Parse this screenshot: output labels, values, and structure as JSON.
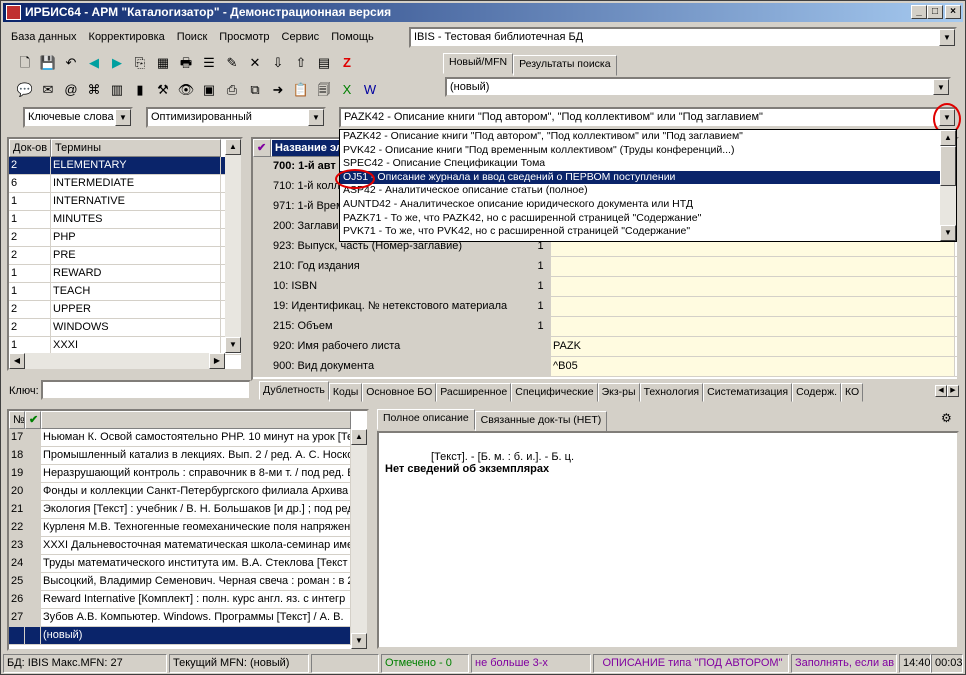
{
  "title": "ИРБИС64 - АРМ \"Каталогизатор\" - Демонстрационная версия",
  "menu": [
    "База данных",
    "Корректировка",
    "Поиск",
    "Просмотр",
    "Сервис",
    "Помощь"
  ],
  "db_combo": "IBIS - Тестовая библиотечная БД",
  "right_tabs": [
    "Новый/MFN",
    "Результаты поиска"
  ],
  "mfn_combo": "(новый)",
  "search_mode": "Ключевые слова",
  "opt_mode": "Оптимизированный",
  "worksheet_combo": "PAZK42 - Описание книги \"Под автором\", \"Под коллективом\" или \"Под заглавием\"",
  "dropdown_items": [
    "PAZK42 - Описание книги \"Под автором\", \"Под коллективом\" или \"Под заглавием\"",
    "PVK42 - Описание книги \"Под временным коллективом\" (Труды конференций...)",
    "SPEC42 - Описание Спецификации Тома",
    "OJ51 - Описание журнала и ввод сведений о ПЕРВОМ поступлении",
    "ASP42 - Аналитическое описание статьи (полное)",
    "AUNTD42 - Аналитическое описание юридического документа или НТД",
    "PAZK71 - То же, что PAZK42, но с расширенной страницей \"Содержание\"",
    "PVK71 - То же, что PVK42, но с расширенной страницей \"Содержание\""
  ],
  "terms": {
    "col_docs": "Док-ов",
    "col_terms": "Термины",
    "rows": [
      {
        "n": "2",
        "t": "ELEMENTARY"
      },
      {
        "n": "6",
        "t": "INTERMEDIATE"
      },
      {
        "n": "1",
        "t": "INTERNATIVE"
      },
      {
        "n": "1",
        "t": "MINUTES"
      },
      {
        "n": "2",
        "t": "PHP"
      },
      {
        "n": "2",
        "t": "PRE"
      },
      {
        "n": "1",
        "t": "REWARD"
      },
      {
        "n": "1",
        "t": "TEACH"
      },
      {
        "n": "2",
        "t": "UPPER"
      },
      {
        "n": "2",
        "t": "WINDOWS"
      },
      {
        "n": "1",
        "t": "XXXI"
      }
    ]
  },
  "key_label": "Ключ:",
  "fields": {
    "col_name": "Название эл",
    "rows": [
      {
        "name": "700: 1-й авт",
        "cnt": "",
        "val": ""
      },
      {
        "name": "710: 1-й колл",
        "cnt": "",
        "val": ""
      },
      {
        "name": "971: 1-й Врем",
        "cnt": "",
        "val": ""
      },
      {
        "name": "200: Заглавие",
        "cnt": "",
        "val": ""
      },
      {
        "name": "923: Выпуск, часть (Номер-заглавие)",
        "cnt": "1",
        "val": ""
      },
      {
        "name": "210: Год издания",
        "cnt": "1",
        "val": ""
      },
      {
        "name": "10: ISBN",
        "cnt": "1",
        "val": ""
      },
      {
        "name": "19: Идентификац. № нетекстового материала",
        "cnt": "1",
        "val": ""
      },
      {
        "name": "215: Объем",
        "cnt": "1",
        "val": ""
      },
      {
        "name": "920: Имя рабочего листа",
        "cnt": "",
        "val": "PAZK"
      },
      {
        "name": "900: Вид документа",
        "cnt": "",
        "val": "^B05"
      }
    ]
  },
  "page_tabs": [
    "Дублетность",
    "Коды",
    "Основное БО",
    "Расширенное",
    "Специфические",
    "Экз-ры",
    "Технология",
    "Систематизация",
    "Содерж.",
    "КО"
  ],
  "records": {
    "col_no": "№",
    "rows": [
      {
        "n": "17",
        "t": "Ньюман К. Освой самостоятельно PHP. 10 минут на урок [Те"
      },
      {
        "n": "18",
        "t": "Промышленный катализ в лекциях. Вып. 2 / ред. А. С. Носко"
      },
      {
        "n": "19",
        "t": "Неразрушающий контроль : справочник в 8-ми т. / под ред. В"
      },
      {
        "n": "20",
        "t": "Фонды и коллекции Санкт-Петербургского филиала Архива Р"
      },
      {
        "n": "21",
        "t": "Экология [Текст] : учебник / В. Н. Большаков [и др.] ; под ред."
      },
      {
        "n": "22",
        "t": "Курленя М.В. Техногенные геомеханические поля напряжен"
      },
      {
        "n": "23",
        "t": "XXXI Дальневосточная математическая школа-семинар име"
      },
      {
        "n": "24",
        "t": "Труды математического института им. В.А. Стеклова [Текст"
      },
      {
        "n": "25",
        "t": "Высоцкий, Владимир Семенович. Черная свеча : роман : в 2"
      },
      {
        "n": "26",
        "t": "Reward Internative [Комплект] : полн. курс англ. яз. с интегр"
      },
      {
        "n": "27",
        "t": "Зубов А.В. Компьютер. Windows. Программы [Текст] / А. В."
      },
      {
        "n": "",
        "t": "(новый)"
      }
    ]
  },
  "desc_tabs": [
    "Полное описание",
    "Связанные док-ты (НЕТ)"
  ],
  "desc_line1": "[Текст]. - [Б. м. : б. и.]. - Б. ц.",
  "desc_line2": "Нет сведений об экземплярах",
  "status": {
    "db": "БД: IBIS Макс.MFN: 27",
    "current": "Текущий MFN: (новый)",
    "marked": "Отмечено - 0",
    "limit": "не больше 3-х",
    "type": "ОПИСАНИЕ типа \"ПОД АВТОРОМ\"",
    "fill": "Заполнять, если ав",
    "time": "14:40",
    "sec": "00:03"
  },
  "colors": {
    "accent": "#0a246a",
    "panel": "#d4d0c8",
    "yellow": "#fffbe0",
    "marked": "#008000",
    "purple": "#a000a0"
  }
}
